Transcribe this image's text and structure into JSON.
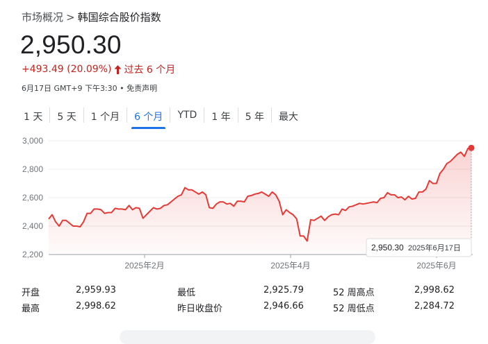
{
  "breadcrumb": {
    "root": "市场概况",
    "separator": ">",
    "current": "韩国综合股价指数"
  },
  "quote": {
    "price": "2,950.30",
    "change": "+493.49 (20.09%)",
    "period": "过去 6 个月",
    "timestamp": "6月17日 GMT+9 下午3:30",
    "disclaimer_sep": "•",
    "disclaimer": "免责声明"
  },
  "tabs": [
    "1 天",
    "5 天",
    "1 个月",
    "6 个月",
    "YTD",
    "1 年",
    "5 年",
    "最大"
  ],
  "active_tab": "6 个月",
  "colors": {
    "line": "#e53935",
    "up": "#c5221f",
    "accent": "#1a73e8"
  },
  "chart_data": {
    "type": "area",
    "y_ticks": [
      "3,000",
      "2,800",
      "2,600",
      "2,400",
      "2,200"
    ],
    "ylim": [
      2200,
      3000
    ],
    "x_ticks": [
      "2025年2月",
      "2025年4月",
      "2025年6月"
    ],
    "grid": true,
    "values": [
      2450,
      2480,
      2430,
      2400,
      2440,
      2440,
      2420,
      2400,
      2400,
      2395,
      2430,
      2490,
      2490,
      2520,
      2520,
      2515,
      2490,
      2495,
      2495,
      2525,
      2520,
      2520,
      2515,
      2545,
      2515,
      2530,
      2525,
      2455,
      2480,
      2505,
      2530,
      2520,
      2525,
      2545,
      2550,
      2570,
      2590,
      2610,
      2620,
      2670,
      2655,
      2655,
      2640,
      2625,
      2640,
      2620,
      2530,
      2525,
      2555,
      2570,
      2570,
      2555,
      2560,
      2540,
      2575,
      2575,
      2570,
      2610,
      2615,
      2625,
      2630,
      2640,
      2625,
      2610,
      2640,
      2620,
      2575,
      2480,
      2515,
      2495,
      2480,
      2450,
      2330,
      2330,
      2295,
      2445,
      2440,
      2455,
      2470,
      2440,
      2465,
      2480,
      2485,
      2480,
      2520,
      2510,
      2535,
      2540,
      2550,
      2560,
      2555,
      2560,
      2565,
      2570,
      2565,
      2595,
      2600,
      2635,
      2620,
      2620,
      2600,
      2605,
      2585,
      2610,
      2590,
      2595,
      2640,
      2640,
      2660,
      2720,
      2700,
      2700,
      2770,
      2800,
      2840,
      2855,
      2880,
      2905,
      2920,
      2890,
      2946,
      2950.3
    ],
    "tooltip": {
      "value": "2,950.30",
      "date": "2025年6月17日"
    }
  },
  "stats": [
    {
      "label": "开盘",
      "value": "2,959.93"
    },
    {
      "label": "最高",
      "value": "2,998.62"
    },
    {
      "label": "最低",
      "value": "2,925.79"
    },
    {
      "label": "昨日收盘价",
      "value": "2,946.66"
    },
    {
      "label": "52 周高点",
      "value": "2,998.62"
    },
    {
      "label": "52 周低点",
      "value": "2,284.72"
    }
  ]
}
